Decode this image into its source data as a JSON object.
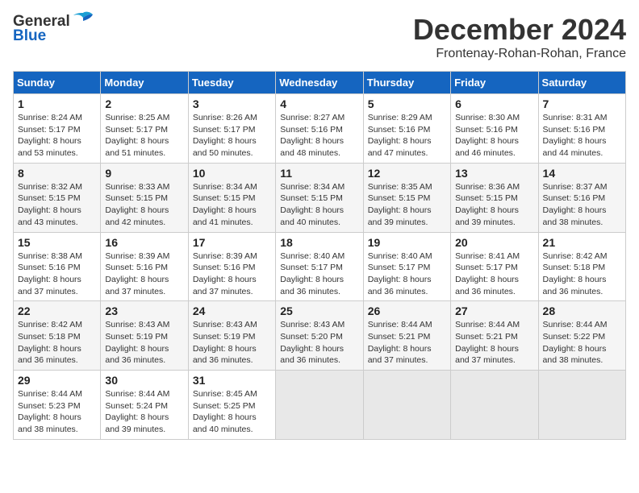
{
  "logo": {
    "general_text": "General",
    "blue_text": "Blue"
  },
  "title": "December 2024",
  "location": "Frontenay-Rohan-Rohan, France",
  "days_of_week": [
    "Sunday",
    "Monday",
    "Tuesday",
    "Wednesday",
    "Thursday",
    "Friday",
    "Saturday"
  ],
  "weeks": [
    [
      {
        "day": "1",
        "sunrise": "8:24 AM",
        "sunset": "5:17 PM",
        "daylight": "8 hours and 53 minutes."
      },
      {
        "day": "2",
        "sunrise": "8:25 AM",
        "sunset": "5:17 PM",
        "daylight": "8 hours and 51 minutes."
      },
      {
        "day": "3",
        "sunrise": "8:26 AM",
        "sunset": "5:17 PM",
        "daylight": "8 hours and 50 minutes."
      },
      {
        "day": "4",
        "sunrise": "8:27 AM",
        "sunset": "5:16 PM",
        "daylight": "8 hours and 48 minutes."
      },
      {
        "day": "5",
        "sunrise": "8:29 AM",
        "sunset": "5:16 PM",
        "daylight": "8 hours and 47 minutes."
      },
      {
        "day": "6",
        "sunrise": "8:30 AM",
        "sunset": "5:16 PM",
        "daylight": "8 hours and 46 minutes."
      },
      {
        "day": "7",
        "sunrise": "8:31 AM",
        "sunset": "5:16 PM",
        "daylight": "8 hours and 44 minutes."
      }
    ],
    [
      {
        "day": "8",
        "sunrise": "8:32 AM",
        "sunset": "5:15 PM",
        "daylight": "8 hours and 43 minutes."
      },
      {
        "day": "9",
        "sunrise": "8:33 AM",
        "sunset": "5:15 PM",
        "daylight": "8 hours and 42 minutes."
      },
      {
        "day": "10",
        "sunrise": "8:34 AM",
        "sunset": "5:15 PM",
        "daylight": "8 hours and 41 minutes."
      },
      {
        "day": "11",
        "sunrise": "8:34 AM",
        "sunset": "5:15 PM",
        "daylight": "8 hours and 40 minutes."
      },
      {
        "day": "12",
        "sunrise": "8:35 AM",
        "sunset": "5:15 PM",
        "daylight": "8 hours and 39 minutes."
      },
      {
        "day": "13",
        "sunrise": "8:36 AM",
        "sunset": "5:15 PM",
        "daylight": "8 hours and 39 minutes."
      },
      {
        "day": "14",
        "sunrise": "8:37 AM",
        "sunset": "5:16 PM",
        "daylight": "8 hours and 38 minutes."
      }
    ],
    [
      {
        "day": "15",
        "sunrise": "8:38 AM",
        "sunset": "5:16 PM",
        "daylight": "8 hours and 37 minutes."
      },
      {
        "day": "16",
        "sunrise": "8:39 AM",
        "sunset": "5:16 PM",
        "daylight": "8 hours and 37 minutes."
      },
      {
        "day": "17",
        "sunrise": "8:39 AM",
        "sunset": "5:16 PM",
        "daylight": "8 hours and 37 minutes."
      },
      {
        "day": "18",
        "sunrise": "8:40 AM",
        "sunset": "5:17 PM",
        "daylight": "8 hours and 36 minutes."
      },
      {
        "day": "19",
        "sunrise": "8:40 AM",
        "sunset": "5:17 PM",
        "daylight": "8 hours and 36 minutes."
      },
      {
        "day": "20",
        "sunrise": "8:41 AM",
        "sunset": "5:17 PM",
        "daylight": "8 hours and 36 minutes."
      },
      {
        "day": "21",
        "sunrise": "8:42 AM",
        "sunset": "5:18 PM",
        "daylight": "8 hours and 36 minutes."
      }
    ],
    [
      {
        "day": "22",
        "sunrise": "8:42 AM",
        "sunset": "5:18 PM",
        "daylight": "8 hours and 36 minutes."
      },
      {
        "day": "23",
        "sunrise": "8:43 AM",
        "sunset": "5:19 PM",
        "daylight": "8 hours and 36 minutes."
      },
      {
        "day": "24",
        "sunrise": "8:43 AM",
        "sunset": "5:19 PM",
        "daylight": "8 hours and 36 minutes."
      },
      {
        "day": "25",
        "sunrise": "8:43 AM",
        "sunset": "5:20 PM",
        "daylight": "8 hours and 36 minutes."
      },
      {
        "day": "26",
        "sunrise": "8:44 AM",
        "sunset": "5:21 PM",
        "daylight": "8 hours and 37 minutes."
      },
      {
        "day": "27",
        "sunrise": "8:44 AM",
        "sunset": "5:21 PM",
        "daylight": "8 hours and 37 minutes."
      },
      {
        "day": "28",
        "sunrise": "8:44 AM",
        "sunset": "5:22 PM",
        "daylight": "8 hours and 38 minutes."
      }
    ],
    [
      {
        "day": "29",
        "sunrise": "8:44 AM",
        "sunset": "5:23 PM",
        "daylight": "8 hours and 38 minutes."
      },
      {
        "day": "30",
        "sunrise": "8:44 AM",
        "sunset": "5:24 PM",
        "daylight": "8 hours and 39 minutes."
      },
      {
        "day": "31",
        "sunrise": "8:45 AM",
        "sunset": "5:25 PM",
        "daylight": "8 hours and 40 minutes."
      },
      null,
      null,
      null,
      null
    ]
  ],
  "labels": {
    "sunrise": "Sunrise:",
    "sunset": "Sunset:",
    "daylight": "Daylight hours"
  }
}
